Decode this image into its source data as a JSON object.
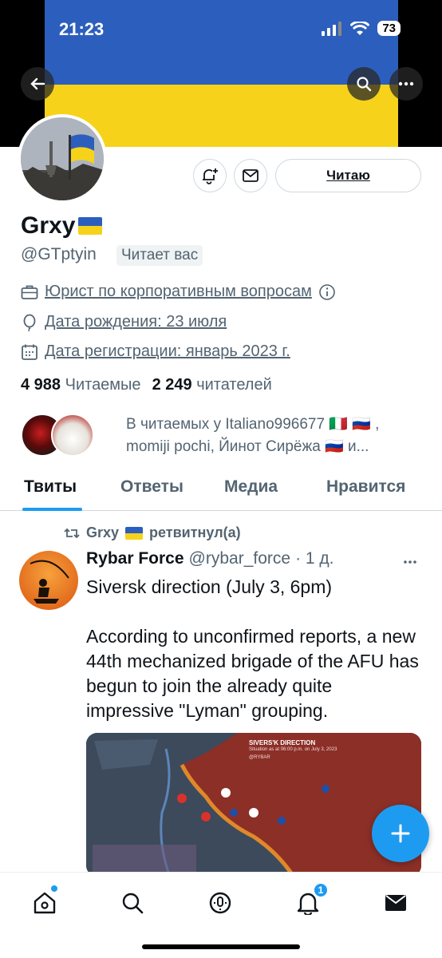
{
  "status_bar": {
    "time": "21:23",
    "battery": "73"
  },
  "profile": {
    "display_name": "Grxy",
    "handle": "@GTptyin",
    "follows_you": "Читает вас",
    "follow_button": "Читаю",
    "occupation": "Юрист по корпоративным вопросам",
    "birthday": "Дата рождения: 23 июля",
    "joined": "Дата регистрации: январь 2023 г.",
    "following_count": "4 988",
    "following_label": "Читаемые",
    "followers_count": "2 249",
    "followers_label": "читателей",
    "known_followers_text": "В читаемых у Italiano996677 🇮🇹 🇷🇺 , momiji pochi, Йинот Сирёжа 🇷🇺 и..."
  },
  "tabs": [
    {
      "label": "Твиты",
      "active": true
    },
    {
      "label": "Ответы",
      "active": false
    },
    {
      "label": "Медиа",
      "active": false
    },
    {
      "label": "Нравится",
      "active": false
    }
  ],
  "tweet": {
    "retweeted_by": "Grxy",
    "retweet_label": "ретвитнул(а)",
    "author_name": "Rybar Force",
    "author_handle": "@rybar_force",
    "time": "· 1 д.",
    "text": "Siversk direction (July 3, 6pm)\n\nAccording to unconfirmed reports, a new 44th mechanized brigade of the AFU has begun to join the already quite impressive \"Lyman\" grouping.",
    "image_title": "SIVERS'K DIRECTION",
    "image_subtitle": "Situation as at 06:00 p.m. on July 3, 2023",
    "image_brand": "@RYBAR"
  },
  "nav": {
    "notifications_badge": "1"
  },
  "colors": {
    "accent": "#1d9bf0",
    "flag_blue": "#2c5fbd",
    "flag_yellow": "#f6d21a"
  }
}
